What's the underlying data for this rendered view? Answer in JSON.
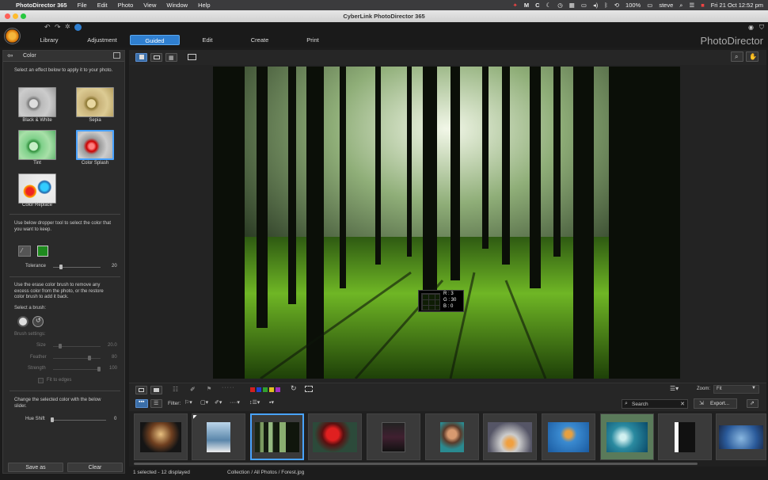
{
  "menubar": {
    "app": "PhotoDirector 365",
    "items": [
      "File",
      "Edit",
      "Photo",
      "View",
      "Window",
      "Help"
    ],
    "battery": "100%",
    "user": "steve",
    "datetime": "Fri 21 Oct  12:52 pm"
  },
  "window": {
    "title": "CyberLink PhotoDirector 365"
  },
  "modules": {
    "library": "Library",
    "adjustment": "Adjustment",
    "guided": "Guided",
    "edit": "Edit",
    "create": "Create",
    "print": "Print"
  },
  "brand": "PhotoDirector",
  "panel": {
    "title": "Color",
    "intro": "Select an effect below to apply it to your photo.",
    "effects": [
      {
        "label": "Black & White"
      },
      {
        "label": "Sepia"
      },
      {
        "label": "Tint"
      },
      {
        "label": "Color Splash"
      },
      {
        "label": "Color Replace"
      }
    ],
    "dropper_text": "Use below dropper tool to select the color that you want to keep.",
    "tolerance_label": "Tolerance",
    "tolerance_value": "20",
    "erase_text": "Use the erase color brush to remove any excess color from the photo, or the restore color brush to add it back.",
    "select_brush": "Select a brush:",
    "brush_settings": "Brush settings:",
    "size_label": "Size",
    "size_value": "20.0",
    "feather_label": "Feather",
    "feather_value": "80",
    "strength_label": "Strength",
    "strength_value": "100",
    "fit_edges": "Fit to edges",
    "hue_text": "Change the selected color with the below slider.",
    "hue_label": "Hue Shift",
    "hue_value": "0",
    "save_as": "Save as",
    "clear": "Clear"
  },
  "picker": {
    "r": "R : 3",
    "g": "G : 30",
    "b": "B : 0"
  },
  "bottom": {
    "zoom_label": "Zoom:",
    "zoom_value": "Fit",
    "filter_label": "Filter:",
    "search_placeholder": "Search",
    "export": "Export..."
  },
  "color_labels": [
    "#d22020",
    "#2040d0",
    "#30a030",
    "#e0c020",
    "#a030c0"
  ],
  "status": {
    "selection": "1 selected - 12 displayed",
    "path": "Collection / All Photos / Forest.jpg"
  }
}
